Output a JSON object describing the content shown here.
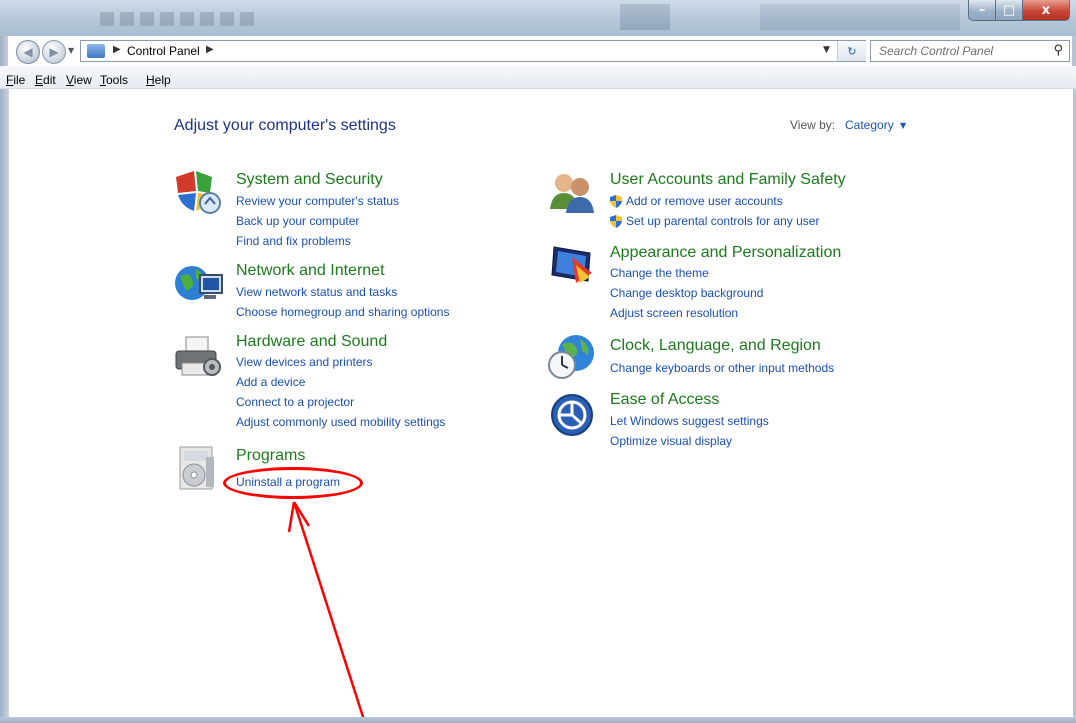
{
  "window": {
    "minimize_glyph": "–",
    "maximize_glyph": "□",
    "close_glyph": "x"
  },
  "address": {
    "breadcrumb": "Control Panel",
    "separator": "▶",
    "search_placeholder": "Search Control Panel"
  },
  "menubar": {
    "items": [
      {
        "accel": "F",
        "rest": "ile"
      },
      {
        "accel": "E",
        "rest": "dit"
      },
      {
        "accel": "V",
        "rest": "iew"
      },
      {
        "accel": "T",
        "rest": "ools"
      },
      {
        "accel": "H",
        "rest": "elp"
      }
    ]
  },
  "main": {
    "title": "Adjust your computer's settings",
    "view_by_label": "View by:",
    "view_by_value": "Category",
    "categories": {
      "system_security": {
        "title": "System and Security",
        "links": [
          "Review your computer's status",
          "Back up your computer",
          "Find and fix problems"
        ]
      },
      "network": {
        "title": "Network and Internet",
        "links": [
          "View network status and tasks",
          "Choose homegroup and sharing options"
        ]
      },
      "hardware": {
        "title": "Hardware and Sound",
        "links": [
          "View devices and printers",
          "Add a device",
          "Connect to a projector",
          "Adjust commonly used mobility settings"
        ]
      },
      "programs": {
        "title": "Programs",
        "links": [
          "Uninstall a program"
        ]
      },
      "user_accounts": {
        "title": "User Accounts and Family Safety",
        "links": [
          "Add or remove user accounts",
          "Set up parental controls for any user"
        ]
      },
      "appearance": {
        "title": "Appearance and Personalization",
        "links": [
          "Change the theme",
          "Change desktop background",
          "Adjust screen resolution"
        ]
      },
      "clock": {
        "title": "Clock, Language, and Region",
        "links": [
          "Change keyboards or other input methods"
        ]
      },
      "ease": {
        "title": "Ease of Access",
        "links": [
          "Let Windows suggest settings",
          "Optimize visual display"
        ]
      }
    }
  },
  "colors": {
    "category_title": "#1c7a1c",
    "link": "#1a4fb5",
    "annotation": "#ff0000"
  }
}
